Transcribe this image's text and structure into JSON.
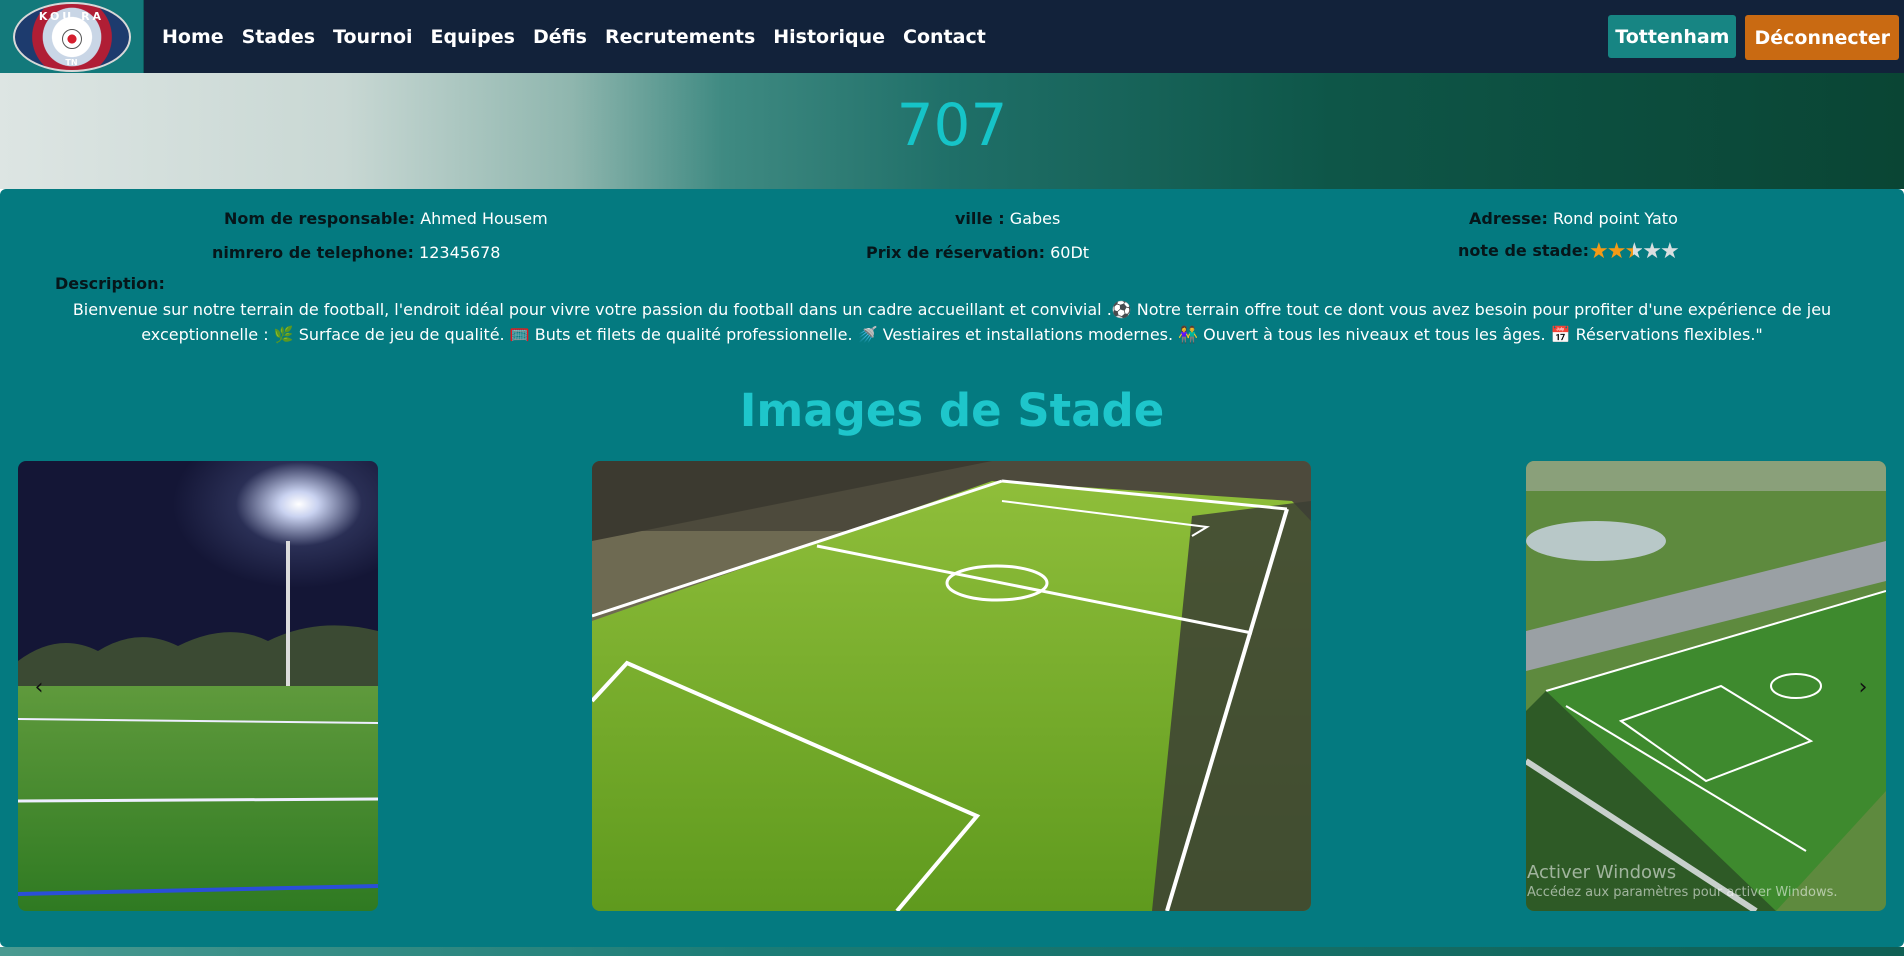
{
  "nav": {
    "logo_text_top": "KOU RA",
    "logo_text_bottom": "TN",
    "links": [
      "Home",
      "Stades",
      "Tournoi",
      "Equipes",
      "Défis",
      "Recrutements",
      "Historique",
      "Contact"
    ],
    "team_button": "Tottenham",
    "logout_button": "Déconnecter"
  },
  "hero": {
    "title": "707"
  },
  "info": {
    "responsable_label": "Nom de responsable:",
    "responsable_value": "Ahmed Housem",
    "ville_label": "ville :",
    "ville_value": "Gabes",
    "adresse_label": "Adresse:",
    "adresse_value": "Rond point Yato",
    "telephone_label": "nimrero de telephone:",
    "telephone_value": "12345678",
    "prix_label": "Prix de réservation:",
    "prix_value": "60Dt",
    "note_label": "note de stade:",
    "rating": 2.5,
    "rating_max": 5
  },
  "description": {
    "label": "Description:",
    "text": "Bienvenue sur notre terrain de football, l'endroit idéal pour vivre votre passion du football dans un cadre accueillant et convivial .⚽ Notre terrain offre tout ce dont vous avez besoin pour profiter d'une expérience de jeu exceptionnelle : 🌿 Surface de jeu de qualité. 🥅 Buts et filets de qualité professionnelle. 🚿 Vestiaires et installations modernes. 👫 Ouvert à tous les niveaux et tous les âges. 📅 Réservations flexibles.\""
  },
  "gallery": {
    "title": "Images de Stade",
    "prev_icon": "chevron-left-icon",
    "next_icon": "chevron-right-icon",
    "prev_glyph": "‹",
    "next_glyph": "›"
  },
  "watermark": {
    "title": "Activer Windows",
    "subtitle": "Accédez aux paramètres pour activer Windows."
  },
  "colors": {
    "navbar": "#12223a",
    "panel": "#047a80",
    "accent_title": "#16c4c8",
    "team_button": "#178583",
    "logout_button": "#c96a12",
    "star_on": "#f59a16"
  }
}
